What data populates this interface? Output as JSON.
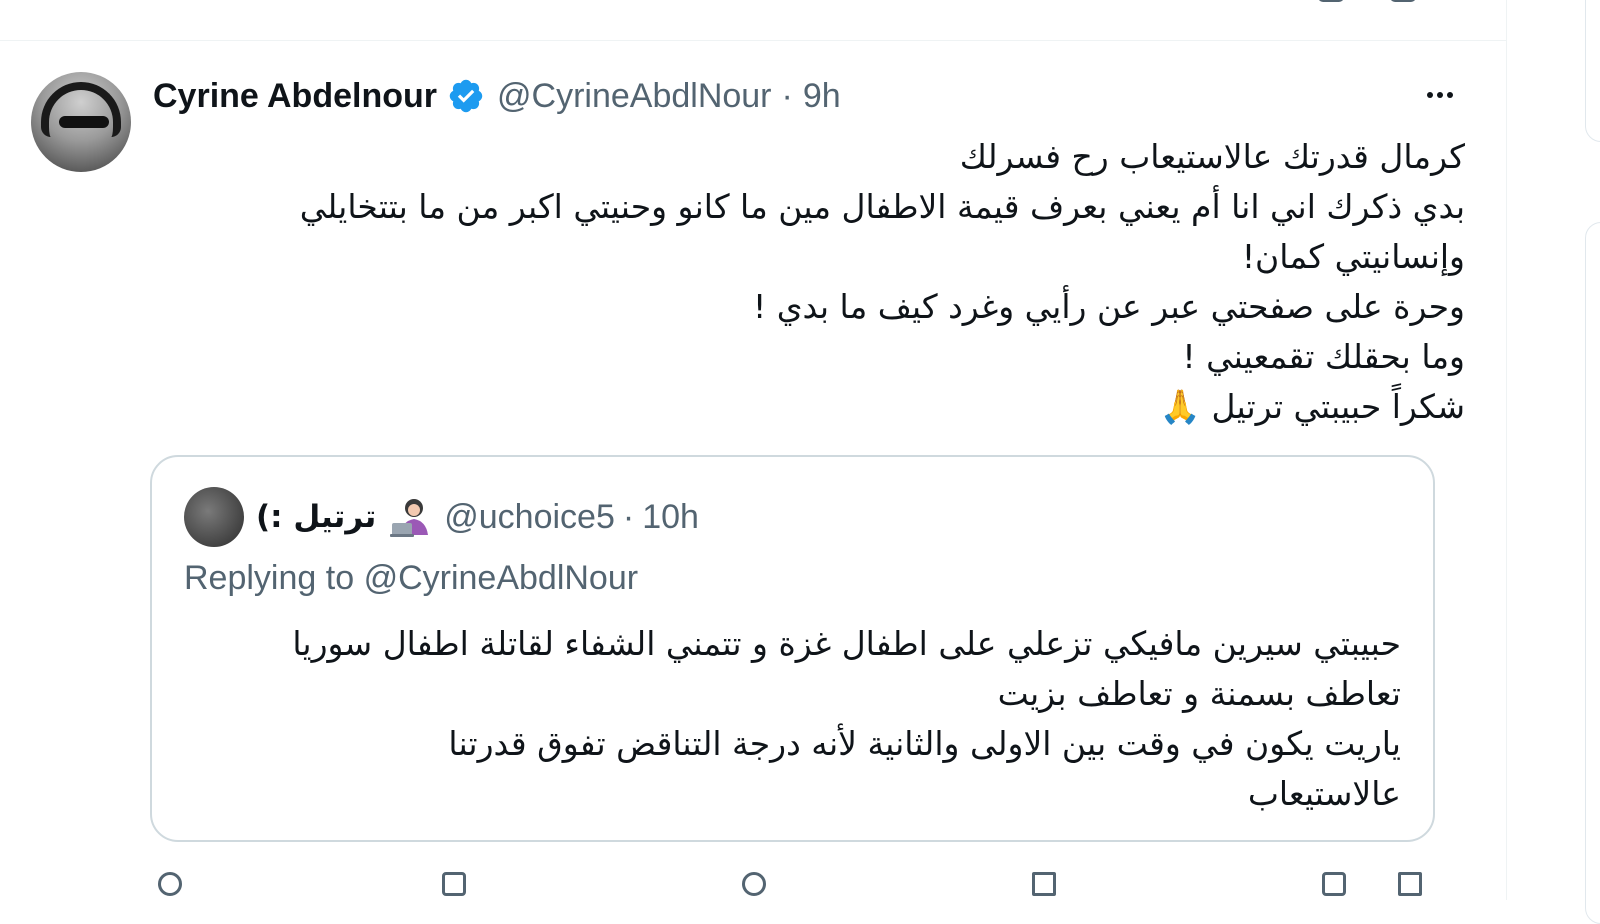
{
  "tweet": {
    "author_name": "Cyrine Abdelnour",
    "handle": "@CyrineAbdlNour",
    "separator": "·",
    "time": "9h",
    "verified_color": "#1d9bf0",
    "lines": [
      "كرمال قدرتك عالاستيعاب رح فسرلك",
      "بدي ذكرك اني انا أم يعني بعرف قيمة الاطفال مين ما كانو وحنيتي اكبر من ما بتتخايلي وإنسانيتي كمان!",
      "وحرة على صفحتي عبر عن رأيي وغرد كيف ما بدي !",
      "وما بحقلك تقمعيني !",
      "شكراً حبيبتي ترتيل 🙏"
    ]
  },
  "quoted_tweet": {
    "author_name": "ترتيل :)",
    "emoji_icon": "person-with-laptop-icon",
    "handle": "@uchoice5",
    "separator": "·",
    "time": "10h",
    "replying_prefix": "Replying to",
    "replying_to": "@CyrineAbdlNour",
    "lines": [
      "حبيبتي سيرين مافيكي تزعلي على اطفال غزة و تتمني الشفاء لقاتلة اطفال سوريا",
      "تعاطف بسمنة و تعاطف بزيت",
      " ياريت يكون في وقت بين الاولى والثانية لأنه درجة التناقض تفوق قدرتنا",
      "عالاستيعاب"
    ]
  }
}
